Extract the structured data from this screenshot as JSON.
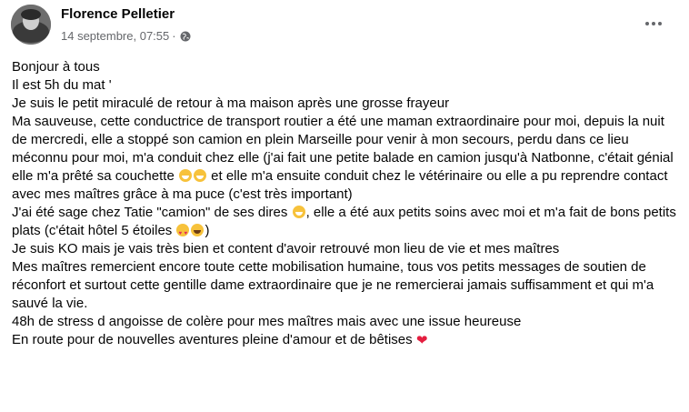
{
  "post": {
    "author": "Florence Pelletier",
    "timestamp": "14 septembre, 07:55",
    "separator": "·",
    "privacy_icon": "globe-icon",
    "more_icon": "more-options-icon",
    "lines": [
      "Bonjour à tous",
      "Il est 5h du mat '",
      "Je suis le petit miraculé de retour à ma maison après une grosse frayeur",
      "Ma sauveuse, cette conductrice de transport routier a été une maman extraordinaire pour moi, depuis la nuit de mercredi, elle a stoppé son camion en plein Marseille pour venir à mon secours, perdu dans ce lieu méconnu pour moi, m'a conduit chez elle (j'ai fait une petite balade en camion jusqu'à Natbonne, c'était génial elle m'a prêté sa couchette",
      "et elle m'a ensuite conduit chez le vétérinaire ou elle a pu reprendre contact avec mes maîtres grâce à ma puce (c'est très important)",
      "J'ai été sage chez Tatie \"camion\" de ses dires",
      ", elle a été aux petits soins avec moi et m'a fait de bons petits plats (c'était hôtel 5 étoiles",
      ")",
      "Je suis KO mais je vais très bien et content d'avoir retrouvé mon lieu de vie et mes maîtres",
      "Mes maîtres remercient encore toute cette mobilisation humaine, tous vos petits messages de soutien de réconfort et surtout cette gentille dame extraordinaire que je ne remercierai jamais suffisamment et qui m'a sauvé la vie.",
      "48h de stress d angoisse de colère pour mes maîtres mais avec une issue heureuse",
      "En route pour de nouvelles aventures pleine d'amour et de bêtises"
    ],
    "emoji": {
      "grin": "grinning-face-emoji",
      "love": "heart-eyes-emoji",
      "laugh": "laughing-face-emoji",
      "heart": "❤"
    }
  }
}
